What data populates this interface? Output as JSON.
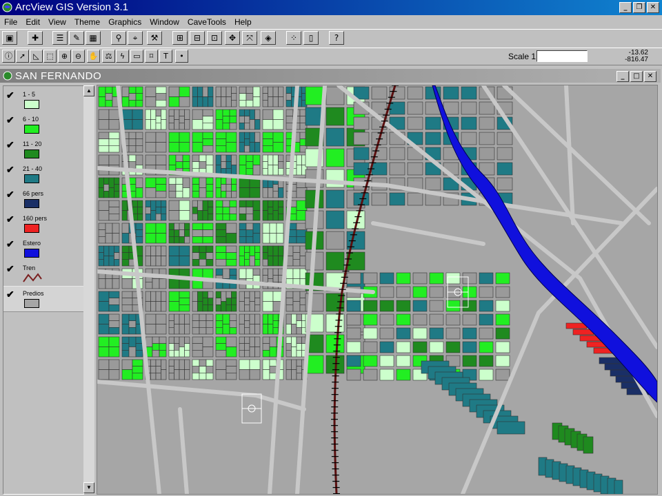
{
  "app": {
    "title": "ArcView GIS Version 3.1"
  },
  "menu": [
    "File",
    "Edit",
    "View",
    "Theme",
    "Graphics",
    "Window",
    "CaveTools",
    "Help"
  ],
  "toolbar": {
    "scale_label": "Scale 1:",
    "scale_value": "",
    "coord_x": "-13.62",
    "coord_y": "-816.47"
  },
  "view": {
    "title": "SAN FERNANDO"
  },
  "legend": [
    {
      "label": "1 - 5",
      "color": "#ccffcc"
    },
    {
      "label": "6 - 10",
      "color": "#22ee22"
    },
    {
      "label": "11 - 20",
      "color": "#1f8a1f"
    },
    {
      "label": "21 - 40",
      "color": "#1f7a85"
    },
    {
      "label": "66 pers",
      "color": "#1a2f66"
    },
    {
      "label": "160 pers",
      "color": "#ee2222"
    },
    {
      "label": "Estero",
      "color": "#1010dd"
    },
    {
      "label": "Tren",
      "color": "#7a2020"
    },
    {
      "label": "Predios",
      "color": "#a6a6a6"
    }
  ]
}
